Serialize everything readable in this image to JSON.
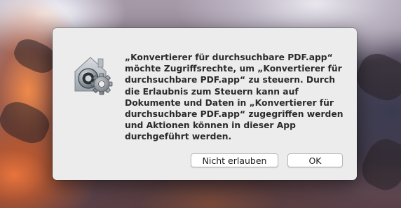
{
  "dialog": {
    "icon": "security-gear-lock-icon",
    "message": "„Konvertierer für durchsuchbare PDF.app“\nmöchte Zugriffsrechte, um „Konvertierer für\ndurchsuchbare PDF.app“ zu steuern. Durch\ndie Erlaubnis zum Steuern kann auf\nDokumente und Daten in „Konvertierer für\ndurchsuchbare PDF.app“ zugegriffen werden\nund Aktionen können in dieser App\ndurchgeführt werden.",
    "buttons": {
      "deny_label": "Nicht erlauben",
      "ok_label": "OK"
    }
  },
  "colors": {
    "dialog_background": "#ececec",
    "text": "#2b2b2b",
    "button_background": "#ffffff"
  }
}
